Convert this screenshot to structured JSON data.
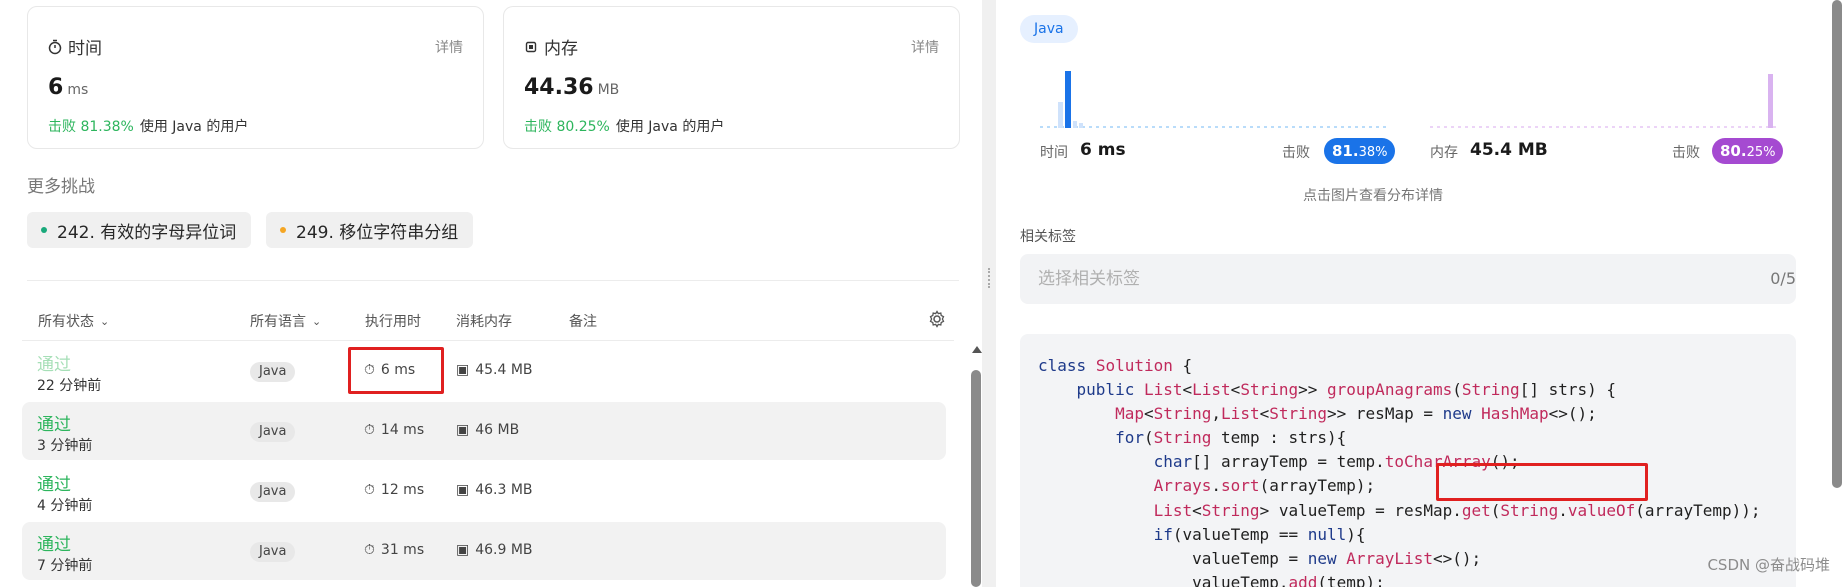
{
  "cards": {
    "time": {
      "title": "时间",
      "detail": "详情",
      "value": "6",
      "unit": "ms",
      "beat_pct": "击败 81.38%",
      "beat_text": "使用 Java 的用户"
    },
    "memory": {
      "title": "内存",
      "detail": "详情",
      "value": "44.36",
      "unit": "MB",
      "beat_pct": "击败 80.25%",
      "beat_text": "使用 Java 的用户"
    }
  },
  "more": {
    "title": "更多挑战",
    "items": [
      {
        "label": "242. 有效的字母异位词",
        "dot": "#19a97b"
      },
      {
        "label": "249. 移位字符串分组",
        "dot": "#f5a623"
      }
    ]
  },
  "table": {
    "headers": {
      "status": "所有状态",
      "lang": "所有语言",
      "runtime": "执行用时",
      "memory": "消耗内存",
      "notes": "备注"
    },
    "rows": [
      {
        "status": "通过",
        "ago": "22 分钟前",
        "lang": "Java",
        "runtime": "6 ms",
        "memory": "45.4 MB"
      },
      {
        "status": "通过",
        "ago": "3 分钟前",
        "lang": "Java",
        "runtime": "14 ms",
        "memory": "46 MB"
      },
      {
        "status": "通过",
        "ago": "4 分钟前",
        "lang": "Java",
        "runtime": "12 ms",
        "memory": "46.3 MB"
      },
      {
        "status": "通过",
        "ago": "7 分钟前",
        "lang": "Java",
        "runtime": "31 ms",
        "memory": "46.9 MB"
      }
    ]
  },
  "right": {
    "lang": "Java",
    "time": {
      "label": "时间",
      "value": "6 ms",
      "beat_label": "击败",
      "beat_big": "81.",
      "beat_small": "38%"
    },
    "mem": {
      "label": "内存",
      "value": "45.4 MB",
      "beat_label": "击败",
      "beat_big": "80.",
      "beat_small": "25%"
    },
    "hint": "点击图片查看分布详情",
    "tags_title": "相关标签",
    "tags_placeholder": "选择相关标签",
    "tags_count": "0/5",
    "colors": {
      "time_bar": "#1a73e8",
      "time_badge": "#1a73e8",
      "mem_bar": "#d9b3f0",
      "mem_badge": "#a54ad1"
    }
  },
  "code": {
    "line1": "class Solution {",
    "line2": "    public List<List<String>> groupAnagrams(String[] strs) {",
    "line3": "        Map<String,List<String>> resMap = new HashMap<>();",
    "line4": "        for(String temp : strs){",
    "line5": "            char[] arrayTemp = temp.toCharArray();",
    "line6": "            Arrays.sort(arrayTemp);",
    "line7": "            List<String> valueTemp = resMap.get(String.valueOf(arrayTemp));",
    "line8": "            if(valueTemp == null){",
    "line9": "                valueTemp = new ArrayList<>();",
    "line10": "                valueTemp.add(temp);"
  },
  "watermark": "CSDN @奋战码堆"
}
